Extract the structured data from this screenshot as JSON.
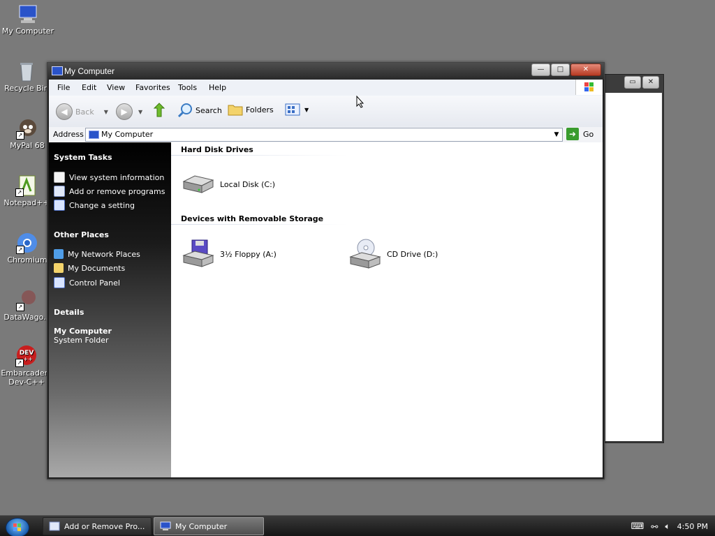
{
  "desktop": {
    "icons": [
      {
        "label": "My Computer",
        "icon": "my-computer-icon"
      },
      {
        "label": "Recycle Bin",
        "icon": "recycle-bin-icon"
      },
      {
        "label": "MyPal 68",
        "icon": "mypal-icon"
      },
      {
        "label": "Notepad++",
        "icon": "notepad-plus-plus-icon"
      },
      {
        "label": "Chromium",
        "icon": "chromium-icon"
      },
      {
        "label": "DataWago...",
        "icon": "datawagon-icon"
      },
      {
        "label": "Embarcadero Dev-C++",
        "icon": "dev-cpp-icon",
        "badge": "DEV"
      }
    ]
  },
  "window": {
    "title": "My Computer",
    "controls": {
      "minimize": "—",
      "maximize": "□",
      "close": "✕"
    },
    "menu": [
      "File",
      "Edit",
      "View",
      "Favorites",
      "Tools",
      "Help"
    ],
    "toolbar": {
      "back": "Back",
      "search": "Search",
      "folders": "Folders"
    },
    "address": {
      "label": "Address",
      "value": "My Computer",
      "go": "Go"
    },
    "taskpane": {
      "system_tasks_title": "System Tasks",
      "system_tasks": [
        "View system information",
        "Add or remove programs",
        "Change a setting"
      ],
      "other_places_title": "Other Places",
      "other_places": [
        "My Network Places",
        "My Documents",
        "Control Panel"
      ],
      "details_title": "Details",
      "details_name": "My Computer",
      "details_type": "System Folder"
    },
    "content": {
      "hard_disk_title": "Hard Disk Drives",
      "hard_disks": [
        "Local Disk (C:)"
      ],
      "removable_title": "Devices with Removable Storage",
      "removable": [
        "3½ Floppy (A:)",
        "CD Drive (D:)"
      ]
    }
  },
  "taskbar": {
    "tasks": [
      "Add or Remove Pro...",
      "My Computer"
    ],
    "clock": "4:50 PM"
  },
  "colors": {
    "accent": "#2a53c9",
    "go_green": "#3a9c2e",
    "taskpane_top": "#000000"
  }
}
